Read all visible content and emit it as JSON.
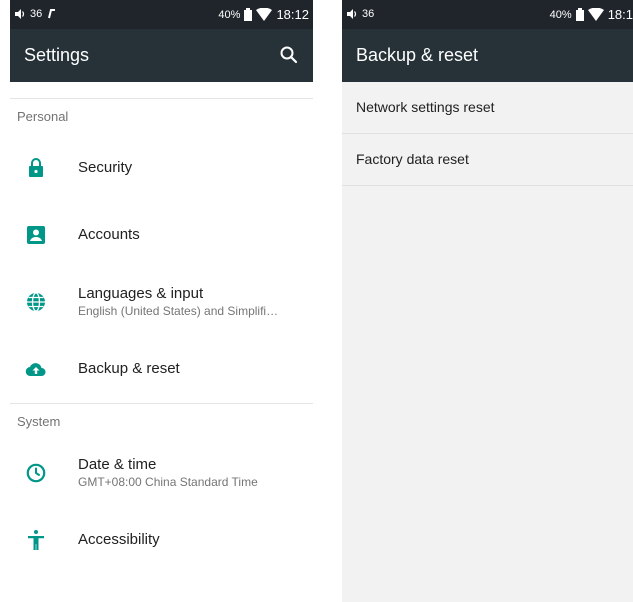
{
  "left_screen": {
    "status": {
      "volume": "36",
      "battery": "40%",
      "time": "18:12"
    },
    "toolbar": {
      "title": "Settings"
    },
    "sections": [
      {
        "header": "Personal",
        "items": [
          {
            "label": "Security"
          },
          {
            "label": "Accounts"
          },
          {
            "label": "Languages & input",
            "summary": "English (United States) and Simplifi…"
          },
          {
            "label": "Backup & reset"
          }
        ]
      },
      {
        "header": "System",
        "items": [
          {
            "label": "Date & time",
            "summary": "GMT+08:00 China Standard Time"
          },
          {
            "label": "Accessibility"
          }
        ]
      }
    ]
  },
  "right_screen": {
    "status": {
      "volume": "36",
      "battery": "40%",
      "time": "18:1"
    },
    "toolbar": {
      "title": "Backup & reset"
    },
    "items": [
      {
        "label": "Network settings reset"
      },
      {
        "label": "Factory data reset"
      }
    ]
  },
  "colors": {
    "toolbar": "#263238",
    "statusbar": "#1f252b",
    "accent": "#009688"
  },
  "icons": [
    "lock-icon",
    "account-box-icon",
    "globe-icon",
    "cloud-upload-icon",
    "clock-icon",
    "accessibility-icon",
    "search-icon"
  ]
}
